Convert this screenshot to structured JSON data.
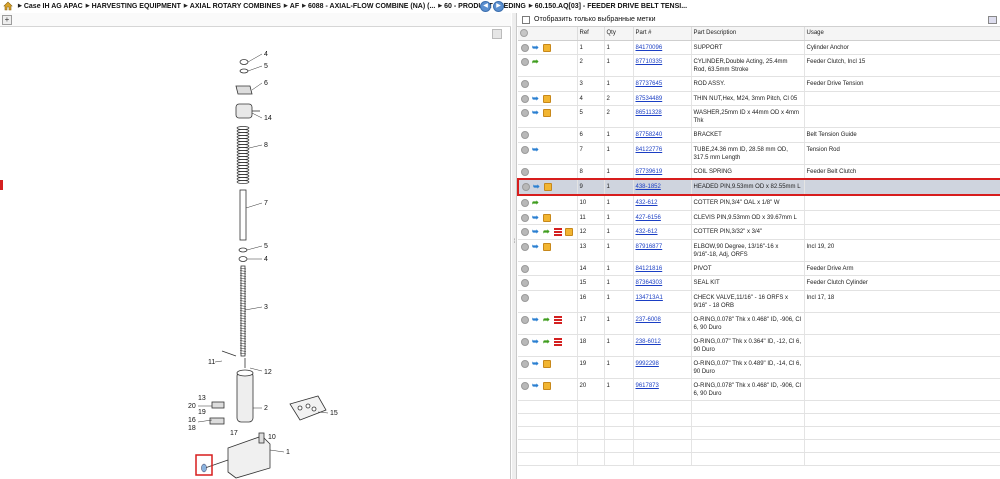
{
  "breadcrumb": {
    "items": [
      "Case IH AG APAC",
      "HARVESTING EQUIPMENT",
      "AXIAL ROTARY COMBINES",
      "AF",
      "6088 - AXIAL-FLOW COMBINE (NA) (...",
      "60 - PRODUCT FEEDING",
      "60.150.AQ[03] - FEEDER DRIVE BELT TENSI..."
    ]
  },
  "nav": {
    "back": "◀",
    "forward": "▶"
  },
  "left": {
    "zoom_label": "+"
  },
  "diagram": {
    "callouts": [
      "4",
      "5",
      "6",
      "14",
      "8",
      "7",
      "5",
      "4",
      "3",
      "11",
      "12",
      "20",
      "13",
      "19",
      "2",
      "16",
      "18",
      "17",
      "10",
      "15",
      "1"
    ],
    "highlighted_part": "9"
  },
  "filter": {
    "label": "Отобразить только выбранные метки"
  },
  "table": {
    "headers": [
      "",
      "Ref",
      "Qty",
      "Part #",
      "Part Description",
      "Usage"
    ],
    "rows": [
      {
        "icons": [
          "circle",
          "info",
          "box"
        ],
        "ref": "1",
        "qty": "1",
        "part": "84170096",
        "desc": "SUPPORT",
        "usage": "Cylinder Anchor"
      },
      {
        "icons": [
          "circle",
          "green"
        ],
        "ref": "2",
        "qty": "1",
        "part": "87710335",
        "desc": "CYLINDER,Double Acting, 25.4mm Rod, 63.5mm Stroke",
        "usage": "Feeder Clutch, Incl 15"
      },
      {
        "icons": [
          "circle"
        ],
        "ref": "3",
        "qty": "1",
        "part": "87737645",
        "desc": "ROD ASSY.",
        "usage": "Feeder Drive Tension"
      },
      {
        "icons": [
          "circle",
          "info",
          "box"
        ],
        "ref": "4",
        "qty": "2",
        "part": "87534489",
        "desc": "THIN NUT,Hex, M24, 3mm Pitch, Cl 05",
        "usage": ""
      },
      {
        "icons": [
          "circle",
          "info",
          "box"
        ],
        "ref": "5",
        "qty": "2",
        "part": "86511328",
        "desc": "WASHER,25mm ID x 44mm OD x 4mm Thk",
        "usage": ""
      },
      {
        "icons": [
          "circle"
        ],
        "ref": "6",
        "qty": "1",
        "part": "87758240",
        "desc": "BRACKET",
        "usage": "Belt Tension Guide"
      },
      {
        "icons": [
          "circle",
          "info"
        ],
        "ref": "7",
        "qty": "1",
        "part": "84122776",
        "desc": "TUBE,24.36 mm ID, 28.58 mm OD, 317.5 mm Length",
        "usage": "Tension Rod"
      },
      {
        "icons": [
          "circle"
        ],
        "ref": "8",
        "qty": "1",
        "part": "87739619",
        "desc": "COIL SPRING",
        "usage": "Feeder Belt Clutch"
      },
      {
        "icons": [
          "circle",
          "info",
          "box"
        ],
        "ref": "9",
        "qty": "1",
        "part": "438-1852",
        "desc": "HEADED PIN,9.53mm OD x 82.55mm L",
        "usage": "",
        "selected": true
      },
      {
        "icons": [
          "circle",
          "green"
        ],
        "ref": "10",
        "qty": "1",
        "part": "432-612",
        "desc": "COTTER PIN,3/4\" OAL x 1/8\" W",
        "usage": ""
      },
      {
        "icons": [
          "circle",
          "info",
          "box"
        ],
        "ref": "11",
        "qty": "1",
        "part": "427-6156",
        "desc": "CLEVIS PIN,9.53mm OD x 39.67mm L",
        "usage": ""
      },
      {
        "icons": [
          "circle",
          "info",
          "green",
          "flag",
          "box"
        ],
        "ref": "12",
        "qty": "1",
        "part": "432-612",
        "desc": "COTTER PIN,3/32\" x 3/4\"",
        "usage": ""
      },
      {
        "icons": [
          "circle",
          "info",
          "box"
        ],
        "ref": "13",
        "qty": "1",
        "part": "87916877",
        "desc": "ELBOW,90 Degree, 13/16\"-16 x 9/16\"-18, Adj, ORFS",
        "usage": "Incl 19, 20"
      },
      {
        "icons": [
          "circle"
        ],
        "ref": "14",
        "qty": "1",
        "part": "84121816",
        "desc": "PIVOT",
        "usage": "Feeder Drive Arm"
      },
      {
        "icons": [
          "circle"
        ],
        "ref": "15",
        "qty": "1",
        "part": "87364303",
        "desc": "SEAL KIT",
        "usage": "Feeder Clutch Cylinder"
      },
      {
        "icons": [
          "circle"
        ],
        "ref": "16",
        "qty": "1",
        "part": "134713A1",
        "desc": "CHECK VALVE,11/16\" - 16 ORFS x 9/16\" - 18 ORB",
        "usage": "Incl 17, 18"
      },
      {
        "icons": [
          "circle",
          "info",
          "green",
          "flag"
        ],
        "ref": "17",
        "qty": "1",
        "part": "237-6008",
        "desc": "O-RING,0.078\" Thk x 0.468\" ID, -906, Cl 6, 90 Duro",
        "usage": ""
      },
      {
        "icons": [
          "circle",
          "info",
          "green",
          "flag"
        ],
        "ref": "18",
        "qty": "1",
        "part": "238-6012",
        "desc": "O-RING,0.07\" Thk x 0.364\" ID, -12, Cl 6, 90 Duro",
        "usage": ""
      },
      {
        "icons": [
          "circle",
          "info",
          "box"
        ],
        "ref": "19",
        "qty": "1",
        "part": "9992298",
        "desc": "O-RING,0.07\" Thk x 0.489\" ID, -14, Cl 6, 90 Duro",
        "usage": ""
      },
      {
        "icons": [
          "circle",
          "info",
          "box"
        ],
        "ref": "20",
        "qty": "1",
        "part": "9617873",
        "desc": "O-RING,0.078\" Thk x 0.468\" ID, -906, Cl 6, 90 Duro",
        "usage": ""
      }
    ]
  },
  "colors": {
    "selection": "#cfd4de",
    "highlight": "#d71d1d",
    "link": "#1a3ec4"
  }
}
